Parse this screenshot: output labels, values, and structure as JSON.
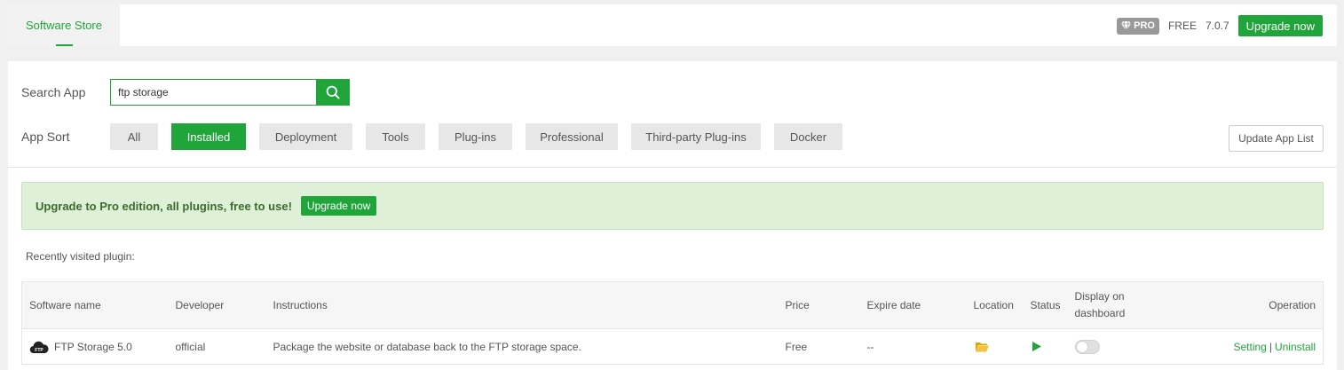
{
  "topbar": {
    "tab_label": "Software Store",
    "pro_badge": "PRO",
    "edition": "FREE",
    "version": "7.0.7",
    "upgrade_label": "Upgrade now"
  },
  "search": {
    "label": "Search App",
    "value": "ftp storage"
  },
  "sort": {
    "label": "App Sort",
    "items": [
      "All",
      "Installed",
      "Deployment",
      "Tools",
      "Plug-ins",
      "Professional",
      "Third-party Plug-ins",
      "Docker"
    ],
    "active": "Installed"
  },
  "update_list_label": "Update App List",
  "promo": {
    "text": "Upgrade to Pro edition, all plugins, free to use!",
    "button": "Upgrade now"
  },
  "recent_label": "Recently visited plugin:",
  "table": {
    "headers": {
      "name": "Software name",
      "developer": "Developer",
      "instructions": "Instructions",
      "price": "Price",
      "expire": "Expire date",
      "location": "Location",
      "status": "Status",
      "dashboard_line1": "Display on",
      "dashboard_line2": "dashboard",
      "operation": "Operation"
    },
    "rows": [
      {
        "name": "FTP Storage 5.0",
        "icon": "ftp-cloud-icon",
        "icon_text": "FTP",
        "developer": "official",
        "instructions": "Package the website or database back to the FTP storage space.",
        "price": "Free",
        "expire": "--",
        "location_icon": "folder-icon",
        "status_icon": "play-icon",
        "dashboard": false,
        "op_setting": "Setting",
        "op_sep": "|",
        "op_uninstall": "Uninstall"
      }
    ]
  },
  "colors": {
    "accent": "#20a53a",
    "promo_bg": "#dff0d8",
    "folder": "#f5b400"
  }
}
